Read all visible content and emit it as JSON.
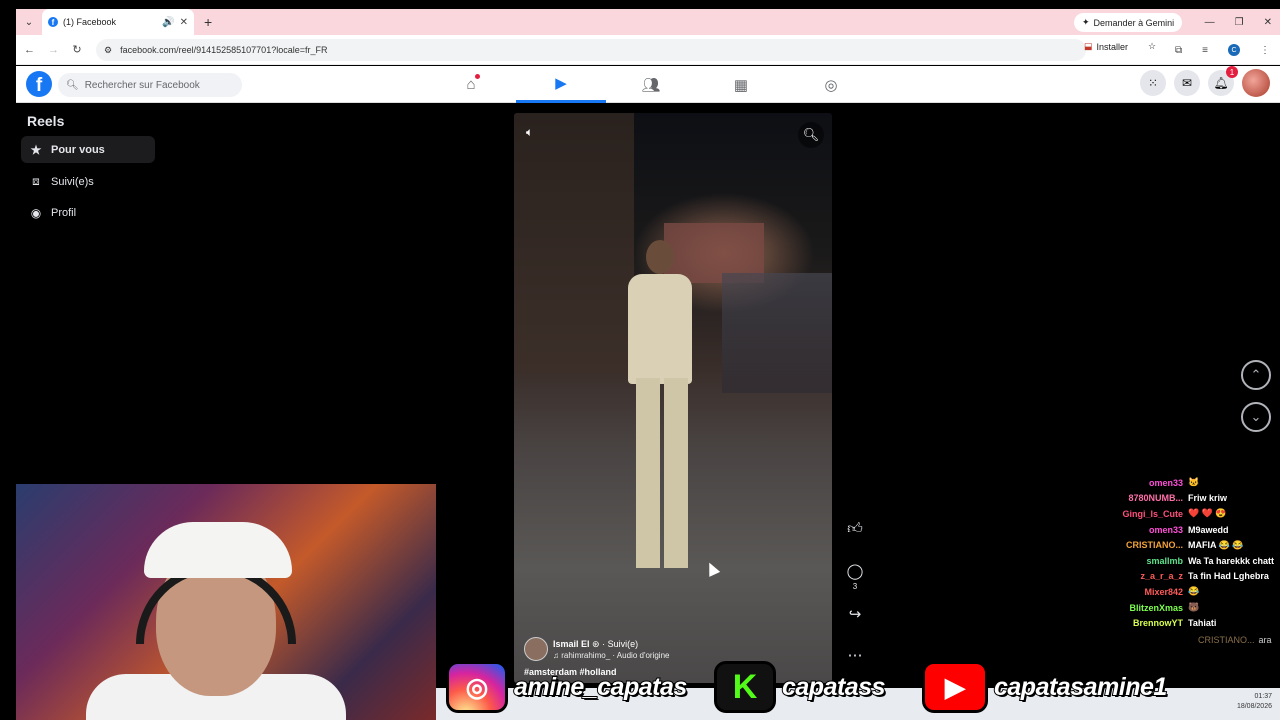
{
  "browser": {
    "tab_count_title": "(1) Facebook",
    "new_tab_symbol": "+",
    "gemini_label": "Demander à Gemini",
    "url": "facebook.com/reel/914152585107701?locale=fr_FR",
    "install_label": "Installer",
    "profile_initial": "C"
  },
  "facebook": {
    "logo_letter": "f",
    "search_placeholder": "Rechercher sur Facebook",
    "notifications_badge": "1",
    "nav_icons": [
      "home-icon",
      "reels-icon",
      "friends-icon",
      "dashboard-icon",
      "groups-icon"
    ],
    "brand_color": "#1877f2"
  },
  "sidebar": {
    "title": "Reels",
    "items": [
      {
        "label": "Pour vous",
        "icon": "star-icon",
        "active": true
      },
      {
        "label": "Suivi(e)s",
        "icon": "following-icon",
        "active": false
      },
      {
        "label": "Profil",
        "icon": "profile-icon",
        "active": false
      }
    ]
  },
  "reel": {
    "author": "Ismail El",
    "follow_state": "· Suivi(e)",
    "audio": "rahimrahimo_ · Audio d'origine",
    "hashtags": "#amsterdam #holland",
    "comment_count": "3"
  },
  "chat": [
    {
      "user": "omen33",
      "msg": "🐱",
      "color": "#ff4fd8"
    },
    {
      "user": "8780NUMB...",
      "msg": "Friw kriw",
      "color": "#ff6fa8"
    },
    {
      "user": "Gingi_ls_Cute",
      "msg": "❤️ ❤️ 😍",
      "color": "#ff4f7a"
    },
    {
      "user": "omen33",
      "msg": "M9awedd",
      "color": "#ff4fd8"
    },
    {
      "user": "CRISTIANO...",
      "msg": "MAFIA 😂 😂",
      "color": "#f2a33a"
    },
    {
      "user": "smallmb",
      "msg": "Wa Ta harekkk chatt",
      "color": "#5fe08a"
    },
    {
      "user": "z_a_r_a_z",
      "msg": "Ta fin Had Lghebra",
      "color": "#ff5a5a"
    },
    {
      "user": "Mixer842",
      "msg": "😂",
      "color": "#ff5a5a"
    },
    {
      "user": "BlitzenXmas",
      "msg": "🐻",
      "color": "#7cff4f"
    },
    {
      "user": "BrennowYT",
      "msg": "Tahiati",
      "color": "#d8ff4f"
    }
  ],
  "chat_last": {
    "user": "CRISTIANO...",
    "msg": "ara"
  },
  "socials": {
    "instagram": "amine_capatas",
    "kick": "capatass",
    "kick_letter": "K",
    "youtube": "capatasamine1"
  },
  "taskbar": {
    "time": "01:37",
    "date": "18/08/2026"
  }
}
